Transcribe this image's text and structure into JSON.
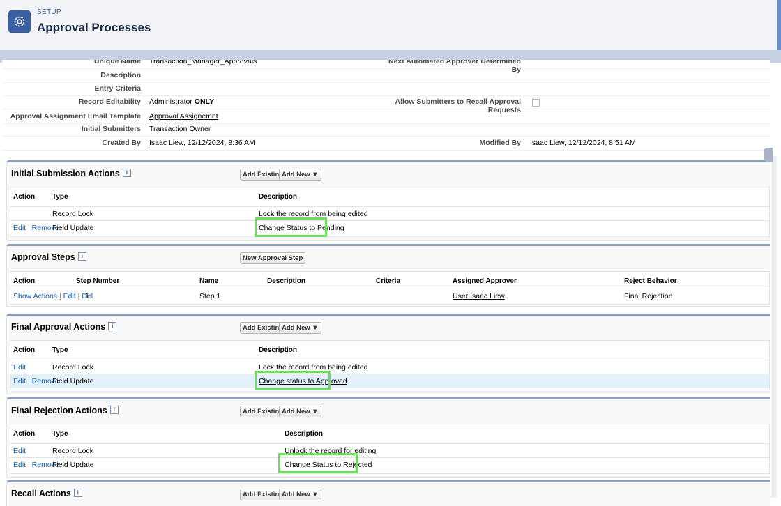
{
  "header": {
    "setup_label": "SETUP",
    "title": "Approval Processes"
  },
  "details": {
    "unique_name_label": "Unique Name",
    "unique_name_value": "Transaction_Manager_Approvals",
    "next_approver_label": "Next Automated Approver Determined By",
    "description_label": "Description",
    "entry_criteria_label": "Entry Criteria",
    "record_editability_label": "Record Editability",
    "record_editability_value_prefix": "Administrator ",
    "record_editability_value_bold": "ONLY",
    "allow_recall_label": "Allow Submitters to Recall Approval Requests",
    "email_template_label": "Approval Assignment Email Template",
    "email_template_value": "Approval Assignemnt",
    "initial_submitters_label": "Initial Submitters",
    "initial_submitters_value": "Transaction Owner",
    "created_by_label": "Created By",
    "created_by_user": "Isaac Liew",
    "created_by_date": ", 12/12/2024, 8:36 AM",
    "modified_by_label": "Modified By",
    "modified_by_user": "Isaac Liew",
    "modified_by_date": ", 12/12/2024, 8:51 AM"
  },
  "buttons": {
    "add_existing": "Add Existing",
    "add_new": "Add New",
    "new_approval_step": "New Approval Step"
  },
  "links": {
    "edit": "Edit",
    "remove": "Remove",
    "show_actions": "Show Actions",
    "del": "Del",
    "separator": "|"
  },
  "initial_submission": {
    "title": "Initial Submission Actions",
    "headers": {
      "action": "Action",
      "type": "Type",
      "description": "Description"
    },
    "rows": [
      {
        "type": "Record Lock",
        "description": "Lock the record from being edited"
      },
      {
        "type": "Field Update",
        "description": "Change Status to Pending"
      }
    ]
  },
  "approval_steps": {
    "title": "Approval Steps",
    "headers": {
      "action": "Action",
      "step_number": "Step Number",
      "name": "Name",
      "description": "Description",
      "criteria": "Criteria",
      "assigned_approver": "Assigned Approver",
      "reject_behavior": "Reject Behavior"
    },
    "rows": [
      {
        "step_number": "1",
        "name": "Step 1",
        "assigned_approver": "User:Isaac Liew",
        "reject_behavior": "Final Rejection"
      }
    ]
  },
  "final_approval": {
    "title": "Final Approval Actions",
    "headers": {
      "action": "Action",
      "type": "Type",
      "description": "Description"
    },
    "rows": [
      {
        "type": "Record Lock",
        "description": "Lock the record from being edited"
      },
      {
        "type": "Field Update",
        "description": "Change status to Approved"
      }
    ]
  },
  "final_rejection": {
    "title": "Final Rejection Actions",
    "headers": {
      "action": "Action",
      "type": "Type",
      "description": "Description"
    },
    "rows": [
      {
        "type": "Record Lock",
        "description": "Unlock the record for editing"
      },
      {
        "type": "Field Update",
        "description": "Change Status to Rejected"
      }
    ]
  },
  "recall": {
    "title": "Recall Actions"
  },
  "colors": {
    "highlight_box": "#6ae05a",
    "link_blue": "#1a5da8",
    "section_border": "#8a9ebe",
    "header_icon": "#3a5fa2"
  }
}
